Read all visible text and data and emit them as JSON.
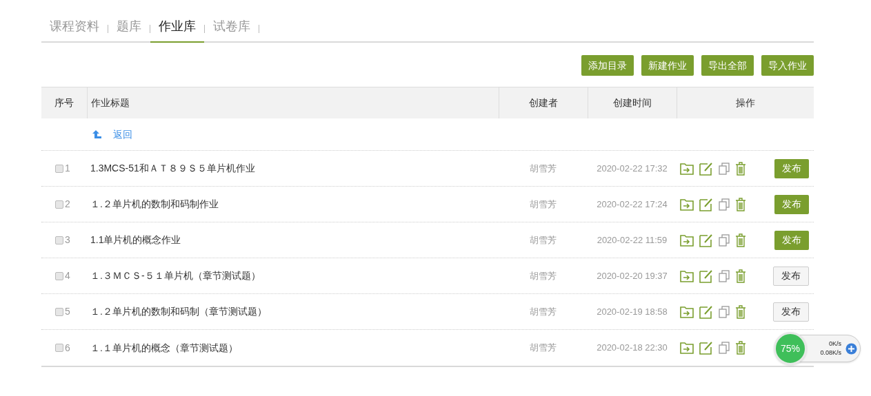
{
  "tabs": [
    {
      "label": "课程资料",
      "selected": false
    },
    {
      "label": "题库",
      "selected": false
    },
    {
      "label": "作业库",
      "selected": true
    },
    {
      "label": "试卷库",
      "selected": false
    }
  ],
  "toolbar": [
    "添加目录",
    "新建作业",
    "导出全部",
    "导入作业"
  ],
  "table": {
    "columns": [
      "序号",
      "作业标题",
      "创建者",
      "创建时间",
      "操作"
    ],
    "back_link": "返回",
    "rows": [
      {
        "index": "1",
        "checked": false,
        "title": "1.3MCS-51和ＡＴ８９Ｓ５单片机作业",
        "creator": "胡雪芳",
        "time": "2020-02-22 17:32",
        "publish": "发布",
        "published": true
      },
      {
        "index": "2",
        "checked": false,
        "title": "１.２单片机的数制和码制作业",
        "creator": "胡雪芳",
        "time": "2020-02-22 17:24",
        "publish": "发布",
        "published": true
      },
      {
        "index": "3",
        "checked": false,
        "title": "1.1单片机的概念作业",
        "creator": "胡雪芳",
        "time": "2020-02-22 11:59",
        "publish": "发布",
        "published": true
      },
      {
        "index": "4",
        "checked": false,
        "title": "１.３ＭＣＳ-５１单片机（章节测试题）",
        "creator": "胡雪芳",
        "time": "2020-02-20 19:37",
        "publish": "发布",
        "published": false
      },
      {
        "index": "5",
        "checked": false,
        "title": "１.２单片机的数制和码制（章节测试题）",
        "creator": "胡雪芳",
        "time": "2020-02-19 18:58",
        "publish": "发布",
        "published": false
      },
      {
        "index": "6",
        "checked": false,
        "title": "１.１单片机的概念（章节测试题）",
        "creator": "胡雪芳",
        "time": "2020-02-18 22:30"
      }
    ]
  },
  "speed_widget": {
    "percent": "75%",
    "upload": "0K/s",
    "download": "0.08K/s"
  }
}
